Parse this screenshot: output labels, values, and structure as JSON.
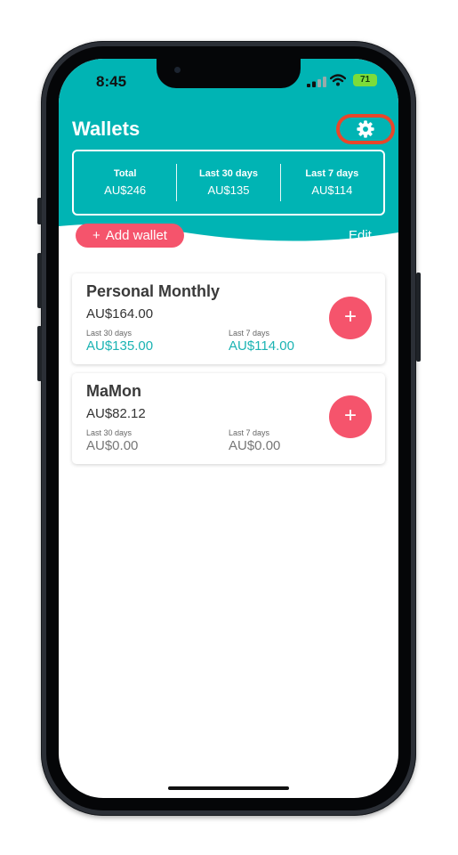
{
  "status_bar": {
    "time": "8:45",
    "battery": "71"
  },
  "header": {
    "title": "Wallets",
    "edit_label": "Edit"
  },
  "summary": [
    {
      "label": "Total",
      "value": "AU$246"
    },
    {
      "label": "Last 30 days",
      "value": "AU$135"
    },
    {
      "label": "Last 7 days",
      "value": "AU$114"
    }
  ],
  "add_wallet": {
    "icon": "+",
    "label": "Add wallet"
  },
  "wallets": [
    {
      "name": "Personal Monthly",
      "balance": "AU$164.00",
      "last30_label": "Last 30 days",
      "last30_value": "AU$135.00",
      "last7_label": "Last 7 days",
      "last7_value": "AU$114.00",
      "add_icon": "+"
    },
    {
      "name": "MaMon",
      "balance": "AU$82.12",
      "last30_label": "Last 30 days",
      "last30_value": "AU$0.00",
      "last7_label": "Last 7 days",
      "last7_value": "AU$0.00",
      "add_icon": "+"
    }
  ],
  "colors": {
    "accent_teal": "#00b4b4",
    "accent_pink": "#f5546c",
    "highlight_ring": "#e8462a"
  },
  "icons": [
    "signal-icon",
    "wifi-icon",
    "battery-icon",
    "gear-icon",
    "plus-icon"
  ]
}
